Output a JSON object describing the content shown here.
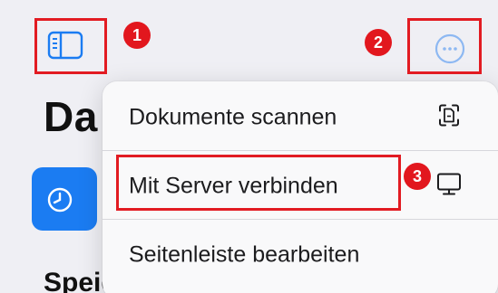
{
  "page": {
    "title": "Da",
    "section_label": "Speicherorte"
  },
  "toolbar": {
    "sidebar_icon": "sidebar-icon",
    "more_icon": "ellipsis-circle-icon"
  },
  "menu": {
    "items": [
      {
        "label": "Dokumente scannen",
        "icon": "doc-scan-icon"
      },
      {
        "label": "Mit Server verbinden",
        "icon": "display-icon"
      },
      {
        "label": "Seitenleiste bearbeiten"
      }
    ]
  },
  "annotations": [
    {
      "number": "1"
    },
    {
      "number": "2"
    },
    {
      "number": "3"
    }
  ],
  "colors": {
    "accent": "#1b7cf2",
    "annotation_red": "#e2171e",
    "background": "#efeff4"
  }
}
